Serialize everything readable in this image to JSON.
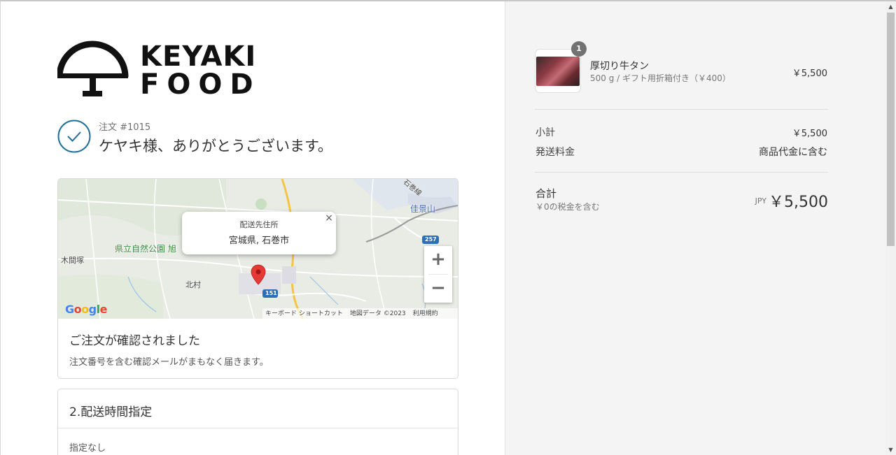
{
  "logo": {
    "line1": "KEYAKI",
    "line2": "FOOD"
  },
  "order": {
    "number": "注文 #1015",
    "thanks": "ケヤキ様、ありがとうございます。"
  },
  "map": {
    "popup_title": "配送先住所",
    "popup_address": "宮城県, 石巻市",
    "popup_close": "×",
    "zoom_in": "+",
    "zoom_out": "−",
    "labels": {
      "park": "県立自然公園 旭",
      "kimazuka": "木間塚",
      "kitamura": "北村",
      "sumiyama": "佳景山",
      "ishinomaki_line": "石巻線",
      "route257": "257",
      "route151": "151"
    },
    "google": "Google",
    "attrib": {
      "keyboard": "キーボード ショートカット",
      "data": "地図データ ©2023",
      "terms": "利用規約"
    }
  },
  "confirmation": {
    "title": "ご注文が確認されました",
    "subtitle": "注文番号を含む確認メールがまもなく届きます。"
  },
  "delivery_time": {
    "title": "2.配送時間指定",
    "value": "指定なし"
  },
  "cart": {
    "badge": "1",
    "item_name": "厚切り牛タン",
    "item_variant": "500 g / ギフト用折箱付き（￥400）",
    "item_price": "￥5,500"
  },
  "summary": {
    "subtotal_label": "小計",
    "subtotal_value": "￥5,500",
    "shipping_label": "発送料金",
    "shipping_value": "商品代金に含む",
    "total_label": "合計",
    "tax_note": "￥0の税金を含む",
    "currency": "JPY",
    "total_value": "￥5,500"
  },
  "colors": {
    "accent": "#1f6f9a",
    "marker": "#e53935",
    "sidebar_bg": "#f4f4f4"
  }
}
